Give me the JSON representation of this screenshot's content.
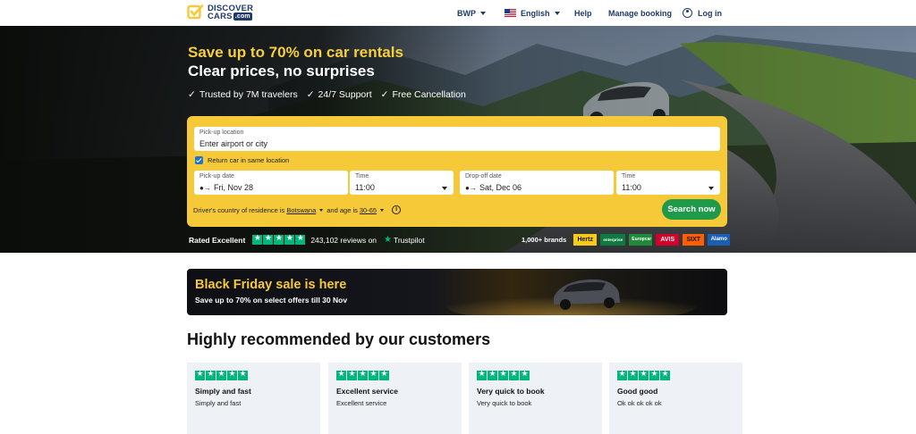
{
  "header": {
    "logo_line1": "DISCOVER",
    "logo_line2": "CARS",
    "logo_com": ".com",
    "currency": "BWP",
    "language": "English",
    "help": "Help",
    "manage_booking": "Manage booking",
    "login": "Log in"
  },
  "hero": {
    "title": "Save up to 70% on car rentals",
    "subtitle": "Clear prices, no surprises",
    "perks": [
      "Trusted by 7M travelers",
      "24/7 Support",
      "Free Cancellation"
    ]
  },
  "search": {
    "pickup_location_label": "Pick-up location",
    "pickup_location_placeholder": "Enter airport or city",
    "return_same_location": "Return car in same location",
    "return_same_checked": true,
    "pickup_date_label": "Pick-up date",
    "pickup_date": "Fri, Nov 28",
    "pickup_time_label": "Time",
    "pickup_time": "11:00",
    "dropoff_date_label": "Drop-off date",
    "dropoff_date": "Sat, Dec 06",
    "dropoff_time_label": "Time",
    "dropoff_time": "11:00",
    "residence_prefix": "Driver's country of residence is",
    "residence_country": "Botswana",
    "age_prefix": "and age is",
    "age_range": "30-65",
    "search_button": "Search now"
  },
  "trust": {
    "rated": "Rated Excellent",
    "reviews": "243,102 reviews on",
    "trustpilot": "Trustpilot",
    "brands_count": "1,000+ brands",
    "brands": [
      {
        "name": "Hertz",
        "bg": "#f7cb16",
        "fg": "#111111"
      },
      {
        "name": "enterprise",
        "bg": "#0d7a3f",
        "fg": "#ffffff"
      },
      {
        "name": "Europcar",
        "bg": "#1f8a3a",
        "fg": "#ffffff"
      },
      {
        "name": "AVIS",
        "bg": "#d4002a",
        "fg": "#ffffff"
      },
      {
        "name": "SIXT",
        "bg": "#ff5f00",
        "fg": "#111111"
      },
      {
        "name": "Alamo",
        "bg": "#1a5fb4",
        "fg": "#ffffff"
      }
    ]
  },
  "banner": {
    "title": "Black Friday sale is here",
    "subtitle": "Save up to 70% on select offers till 30 Nov"
  },
  "reviews": {
    "section_title": "Highly recommended by our customers",
    "items": [
      {
        "title": "Simply and fast",
        "text": "Simply and fast",
        "rating": 5
      },
      {
        "title": "Excellent service",
        "text": "Excellent service",
        "rating": 5
      },
      {
        "title": "Very quick to book",
        "text": "Very quick to book",
        "rating": 5
      },
      {
        "title": "Good good",
        "text": "Ok ok ok ok ok",
        "rating": 5
      }
    ]
  },
  "colors": {
    "brand_yellow": "#f6c939",
    "button_green": "#1e9a4a",
    "trustpilot_green": "#00b67a",
    "navy": "#1f3b6b"
  }
}
